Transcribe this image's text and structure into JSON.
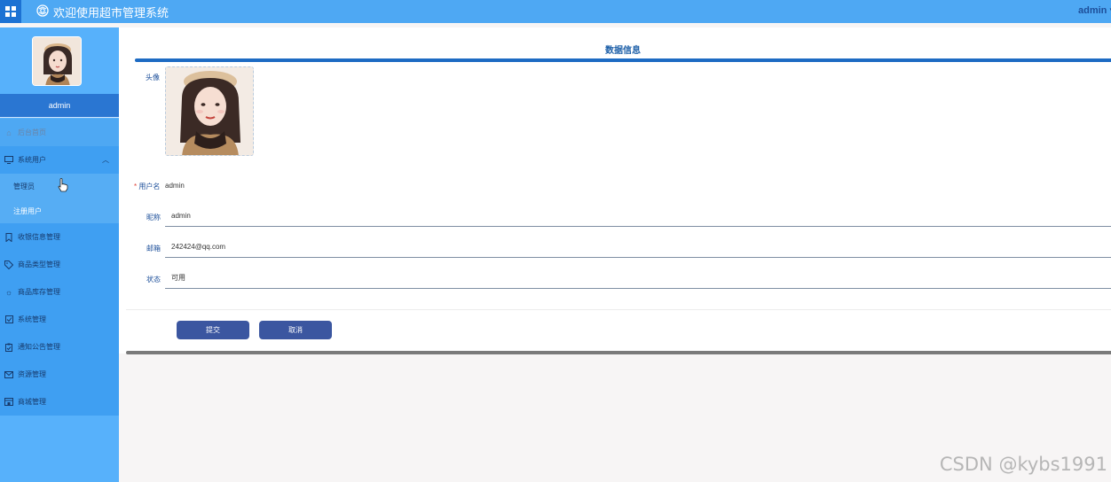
{
  "header": {
    "title": "欢迎使用超市管理系统",
    "user": "admin",
    "user_caret": "▾"
  },
  "sidebar": {
    "username": "admin",
    "items": [
      {
        "label": "后台首页",
        "icon": "home-icon"
      },
      {
        "label": "系统用户",
        "icon": "monitor-icon",
        "expanded": true,
        "children": [
          {
            "label": "管理员"
          },
          {
            "label": "注册用户",
            "active": true
          }
        ]
      },
      {
        "label": "收银信息管理",
        "icon": "bookmark-icon"
      },
      {
        "label": "商品类型管理",
        "icon": "tag-icon"
      },
      {
        "label": "商品库存管理",
        "icon": "sun-icon"
      },
      {
        "label": "系统管理",
        "icon": "checkbox-icon"
      },
      {
        "label": "通知公告管理",
        "icon": "clipboard-icon"
      },
      {
        "label": "资源管理",
        "icon": "mail-icon"
      },
      {
        "label": "商城管理",
        "icon": "store-icon"
      }
    ]
  },
  "form": {
    "title": "数据信息",
    "avatar_label": "头像",
    "username_label": "用户名",
    "username_required": "*",
    "username_value": "admin",
    "nickname_label": "昵称",
    "nickname_value": "admin",
    "email_label": "邮箱",
    "email_value": "242424@qq.com",
    "status_label": "状态",
    "status_value": "可用",
    "submit_label": "提交",
    "cancel_label": "取消"
  },
  "watermark": "CSDN @kybs1991",
  "colors": {
    "topbar": "#4ea8f3",
    "sidebar": "#57b1fb",
    "sidebar_active_bar": "#2a76d2",
    "accent_line": "#1d6bc3",
    "button": "#3b56a0"
  }
}
